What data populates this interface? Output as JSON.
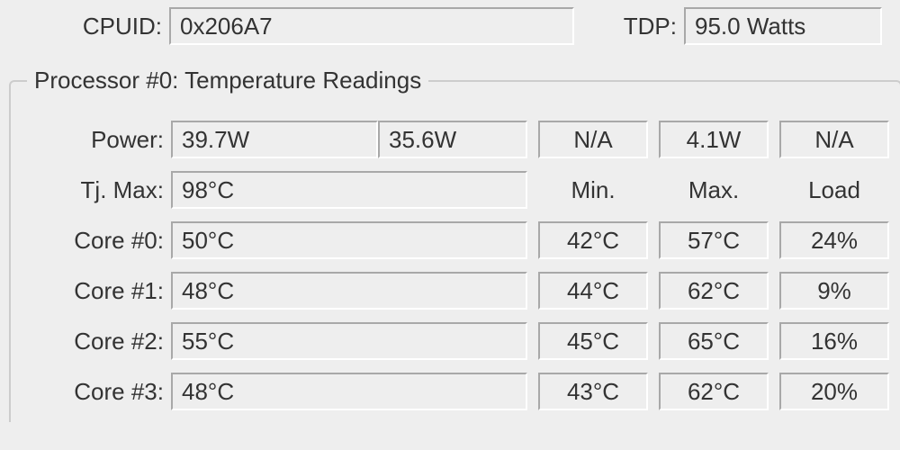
{
  "top": {
    "cpuid_label": "CPUID:",
    "cpuid_value": "0x206A7",
    "tdp_label": "TDP:",
    "tdp_value": "95.0 Watts"
  },
  "group_title": "Processor #0: Temperature Readings",
  "power": {
    "label": "Power:",
    "v1": "39.7W",
    "v2": "35.6W",
    "v3": "N/A",
    "v4": "4.1W",
    "v5": "N/A"
  },
  "tjmax": {
    "label": "Tj. Max:",
    "value": "98°C",
    "h_min": "Min.",
    "h_max": "Max.",
    "h_load": "Load"
  },
  "cores": [
    {
      "label": "Core #0:",
      "cur": "50°C",
      "min": "42°C",
      "max": "57°C",
      "load": "24%"
    },
    {
      "label": "Core #1:",
      "cur": "48°C",
      "min": "44°C",
      "max": "62°C",
      "load": "9%"
    },
    {
      "label": "Core #2:",
      "cur": "55°C",
      "min": "45°C",
      "max": "65°C",
      "load": "16%"
    },
    {
      "label": "Core #3:",
      "cur": "48°C",
      "min": "43°C",
      "max": "62°C",
      "load": "20%"
    }
  ]
}
